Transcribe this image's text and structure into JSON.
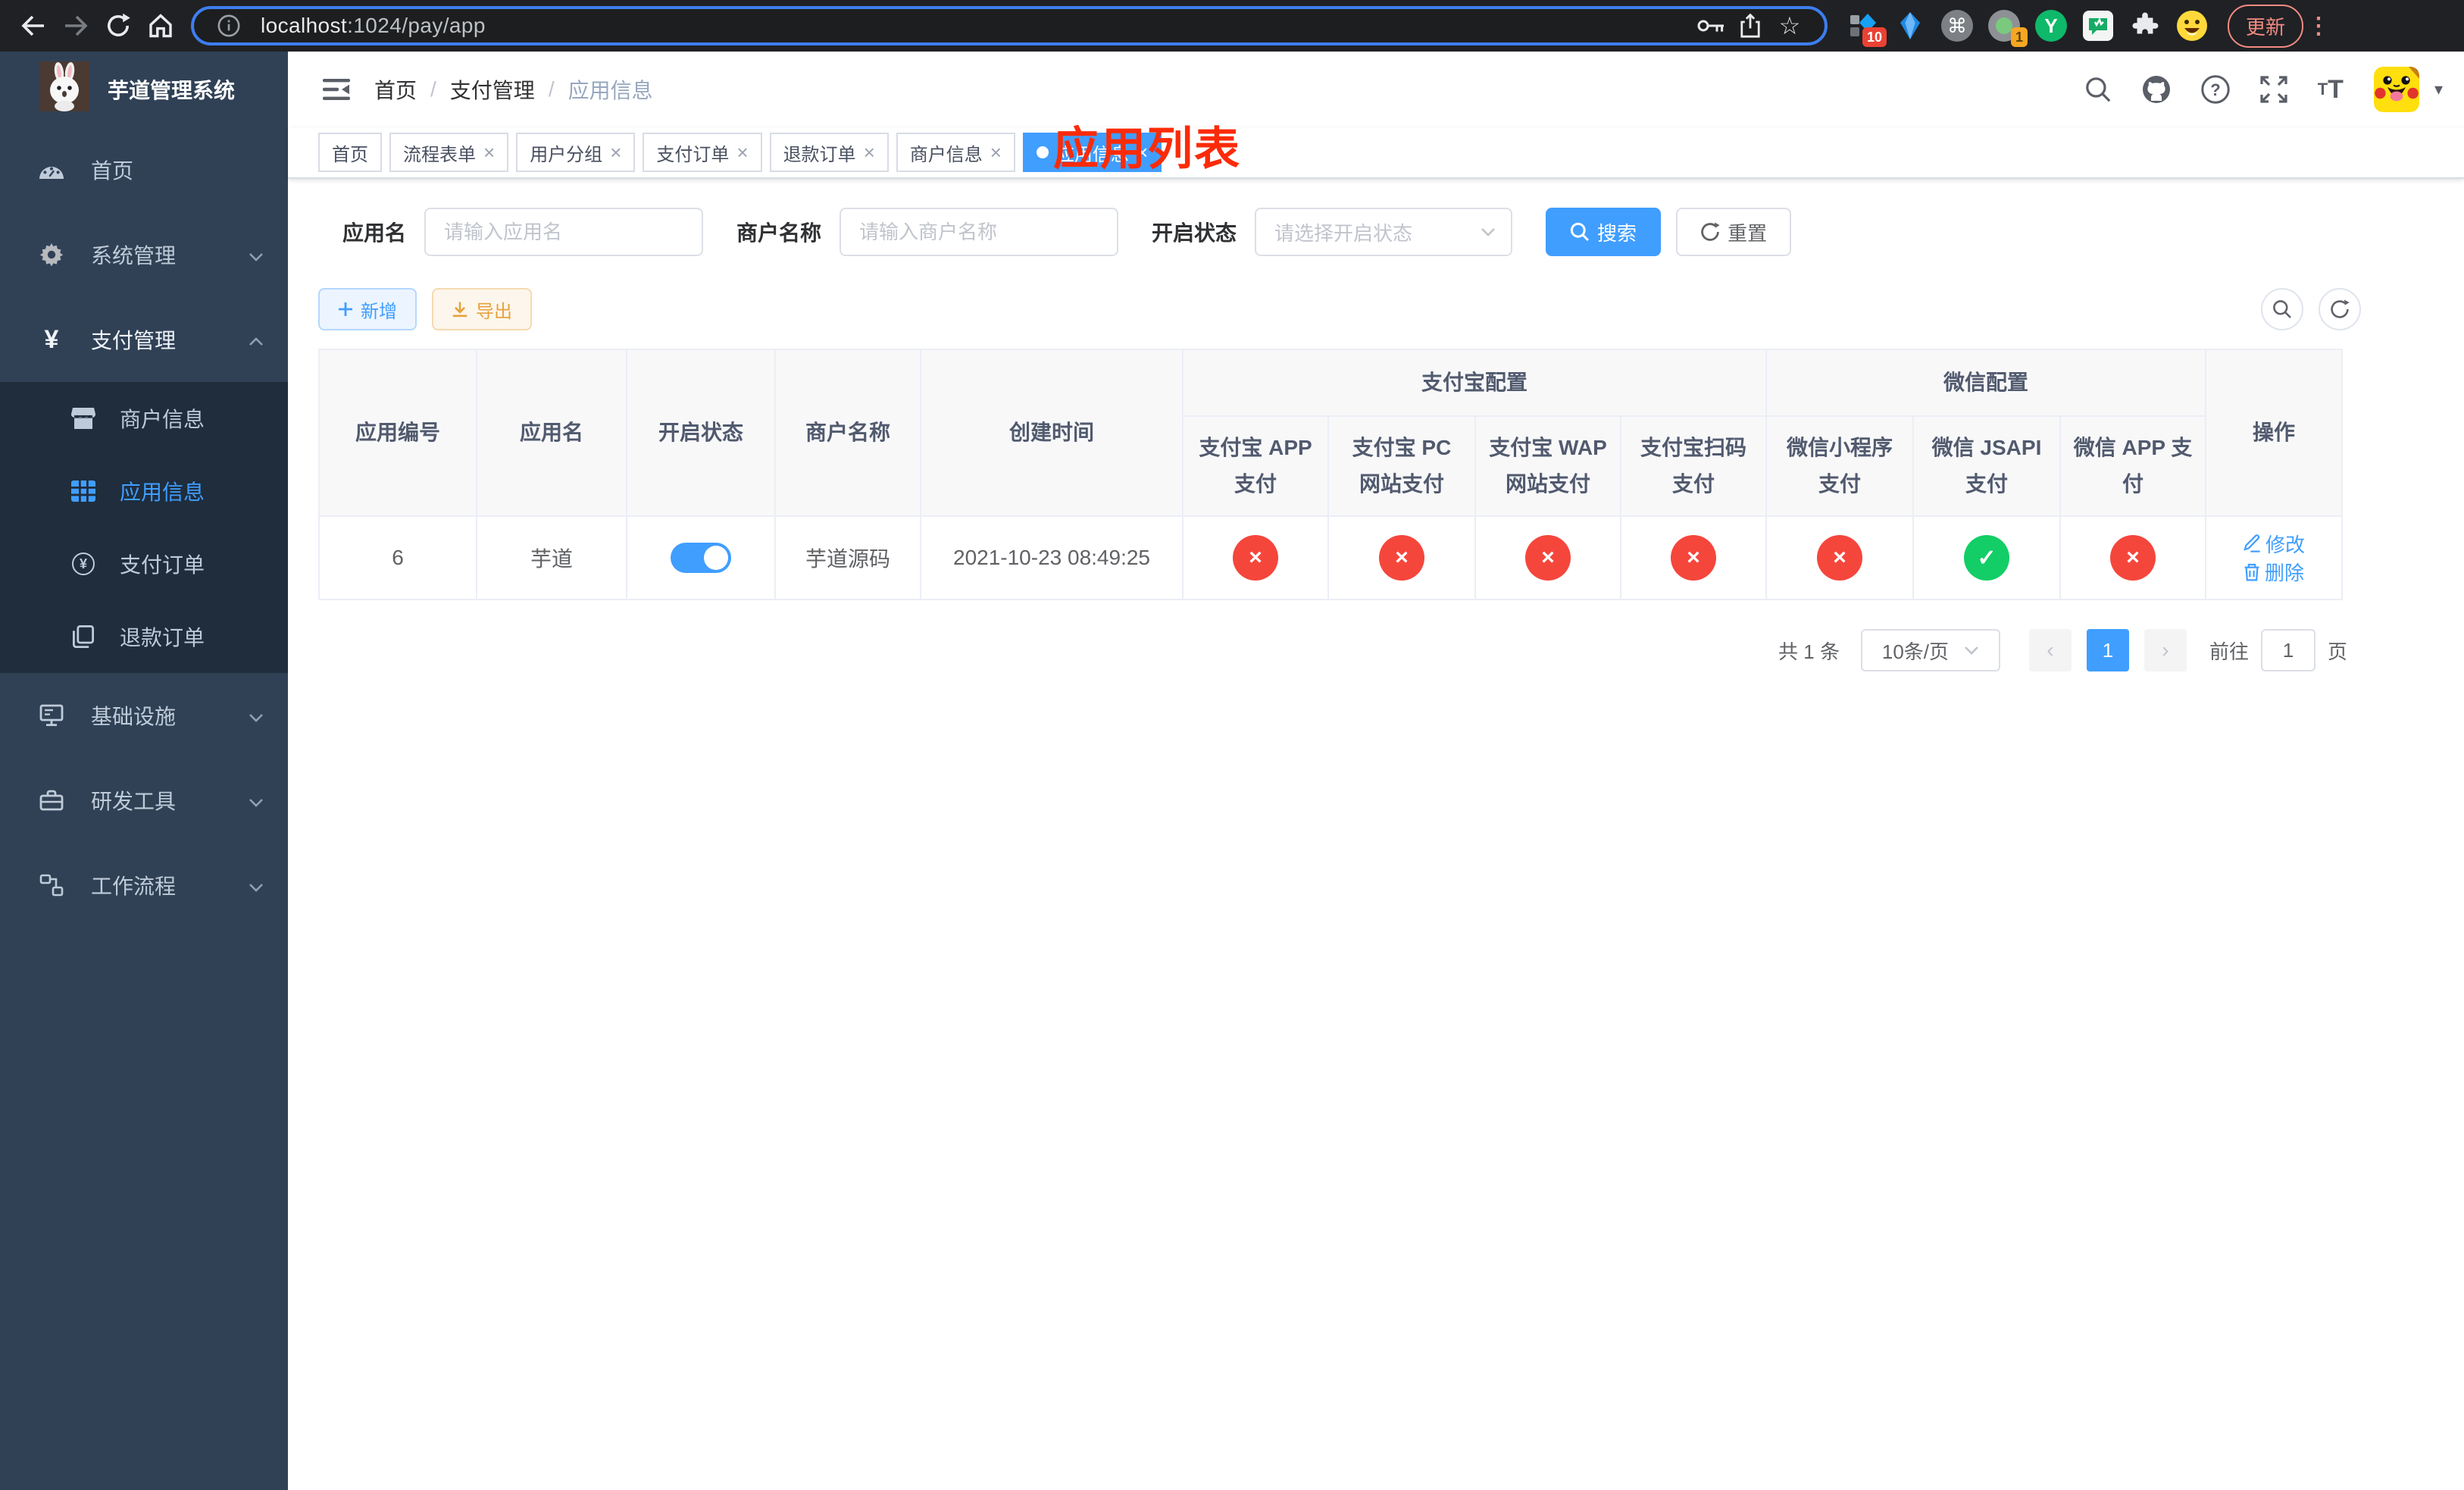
{
  "colors": {
    "accent": "#409eff",
    "danger": "#f5463c",
    "success": "#13ce66",
    "warning": "#e6a23c",
    "overlay_red": "#fb2b08",
    "sidebar_bg": "#304156",
    "submenu_bg": "#1f2d3d"
  },
  "browser": {
    "url_host": "localhost",
    "url_rest": ":1024/pay/app",
    "update_label": "更新",
    "ext_badge_blocks": "10",
    "ext_badge_recorder": "1"
  },
  "sidebar": {
    "title": "芋道管理系统",
    "items": [
      {
        "label": "首页"
      },
      {
        "label": "系统管理"
      },
      {
        "label": "支付管理"
      },
      {
        "label": "基础设施"
      },
      {
        "label": "研发工具"
      },
      {
        "label": "工作流程"
      }
    ],
    "payment_children": [
      {
        "label": "商户信息"
      },
      {
        "label": "应用信息"
      },
      {
        "label": "支付订单"
      },
      {
        "label": "退款订单"
      }
    ]
  },
  "header": {
    "breadcrumb": [
      "首页",
      "支付管理",
      "应用信息"
    ],
    "overlay_title": "应用列表"
  },
  "tabs": [
    {
      "label": "首页",
      "closable": false,
      "active": false
    },
    {
      "label": "流程表单",
      "closable": true,
      "active": false
    },
    {
      "label": "用户分组",
      "closable": true,
      "active": false
    },
    {
      "label": "支付订单",
      "closable": true,
      "active": false
    },
    {
      "label": "退款订单",
      "closable": true,
      "active": false
    },
    {
      "label": "商户信息",
      "closable": true,
      "active": false
    },
    {
      "label": "应用信息",
      "closable": true,
      "active": true
    }
  ],
  "filters": {
    "app_name": {
      "label": "应用名",
      "placeholder": "请输入应用名"
    },
    "merchant": {
      "label": "商户名称",
      "placeholder": "请输入商户名称"
    },
    "status": {
      "label": "开启状态",
      "placeholder": "请选择开启状态"
    },
    "search_label": "搜索",
    "reset_label": "重置"
  },
  "toolbar": {
    "add_label": "新增",
    "export_label": "导出"
  },
  "table": {
    "plain_columns": [
      "应用编号",
      "应用名",
      "开启状态",
      "商户名称",
      "创建时间"
    ],
    "groups": [
      {
        "label": "支付宝配置",
        "children": [
          "支付宝 APP 支付",
          "支付宝 PC 网站支付",
          "支付宝 WAP 网站支付",
          "支付宝扫码支付"
        ]
      },
      {
        "label": "微信配置",
        "children": [
          "微信小程序支付",
          "微信 JSAPI 支付",
          "微信 APP 支付"
        ]
      }
    ],
    "action_column": "操作",
    "rows": [
      {
        "app_id": "6",
        "app_name": "芋道",
        "enabled": true,
        "merchant_name": "芋道源码",
        "create_time": "2021-10-23 08:49:25",
        "statuses": [
          "no",
          "no",
          "no",
          "no",
          "no",
          "yes",
          "no"
        ],
        "edit_label": "修改",
        "delete_label": "删除"
      }
    ]
  },
  "pagination": {
    "total": "共 1 条",
    "page_size": "10条/页",
    "page": "1",
    "goto_label": "前往",
    "goto_value": "1",
    "goto_unit": "页"
  }
}
